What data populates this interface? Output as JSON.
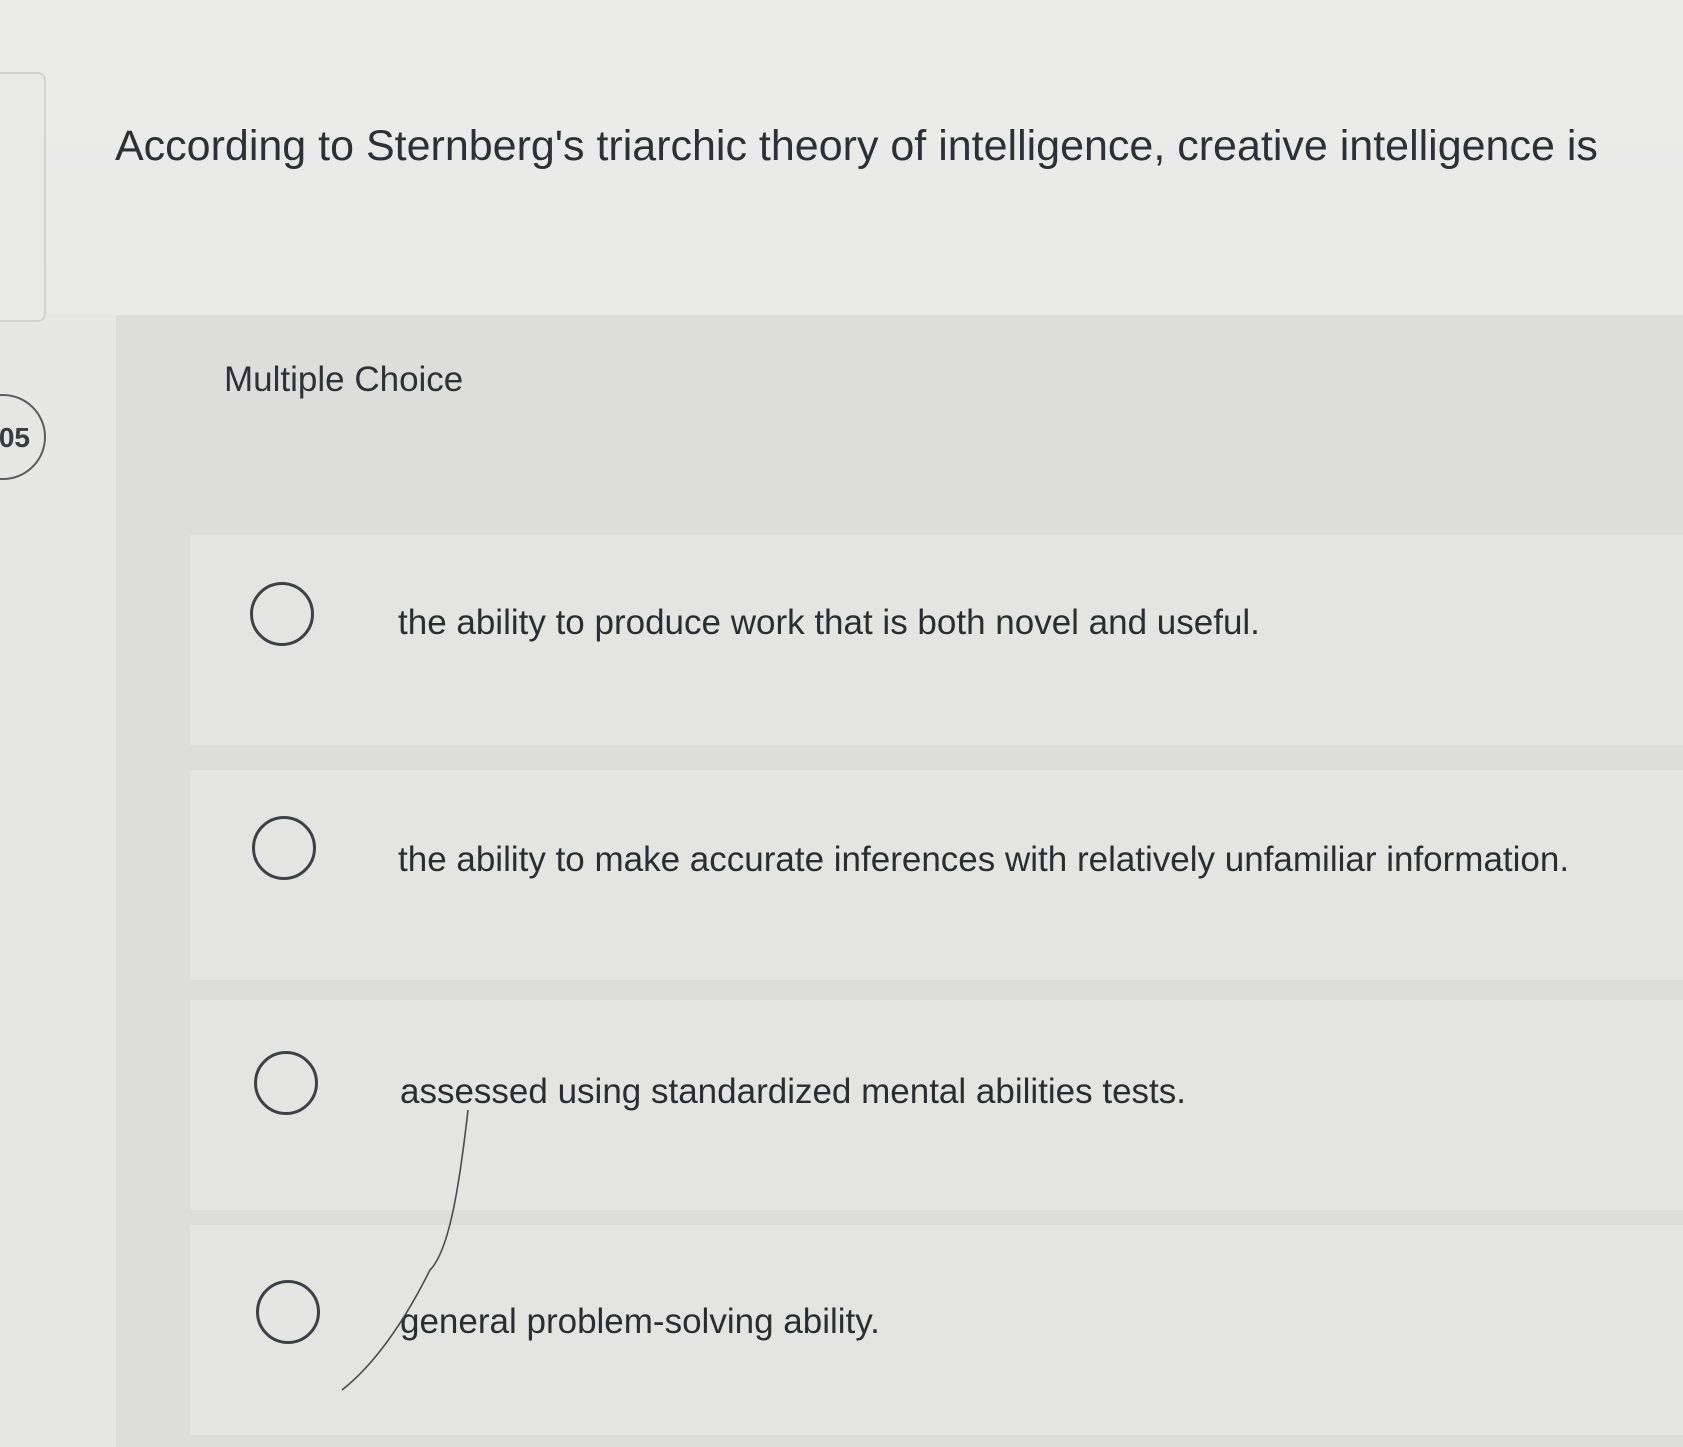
{
  "question": {
    "number": "05",
    "text": "According to Sternberg's triarchic theory of intelligence, creative intelligence is"
  },
  "question_type": "Multiple Choice",
  "options": [
    {
      "label": "the ability to produce work that is both novel and useful.",
      "selected": false
    },
    {
      "label": "the ability to make accurate inferences with relatively unfamiliar information.",
      "selected": false
    },
    {
      "label": "assessed using standardized mental abilities tests.",
      "selected": false
    },
    {
      "label": "general problem-solving ability.",
      "selected": false
    }
  ],
  "icons": {
    "radio": "radio-unchecked-icon"
  }
}
